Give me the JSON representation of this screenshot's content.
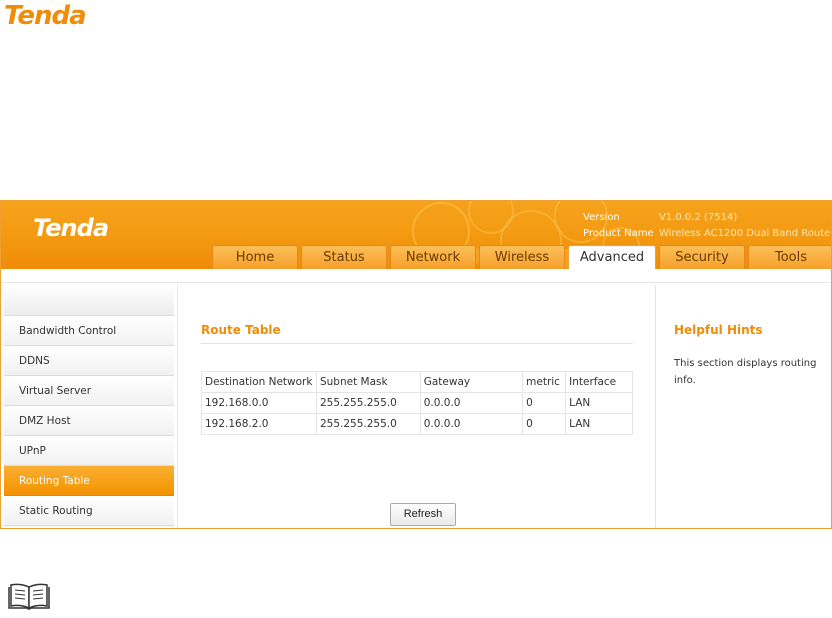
{
  "brand": {
    "logo_text": "Tenda",
    "accent_color": "#f39a12",
    "logo_color_doc": "#f08c08"
  },
  "header": {
    "version_label": "Version",
    "version_value": "V1.0.0.2 (7514)",
    "product_label": "Product Name",
    "product_value": "Wireless AC1200 Dual Band Router"
  },
  "tabs": [
    {
      "label": "Home"
    },
    {
      "label": "Status"
    },
    {
      "label": "Network"
    },
    {
      "label": "Wireless"
    },
    {
      "label": "Advanced",
      "active": true
    },
    {
      "label": "Security"
    },
    {
      "label": "Tools"
    }
  ],
  "sidebar": {
    "items": [
      {
        "label": "Bandwidth Control"
      },
      {
        "label": "DDNS"
      },
      {
        "label": "Virtual Server"
      },
      {
        "label": "DMZ Host"
      },
      {
        "label": "UPnP"
      },
      {
        "label": "Routing Table",
        "active": true
      },
      {
        "label": "Static Routing"
      }
    ]
  },
  "main": {
    "title": "Route Table",
    "columns": [
      "Destination Network",
      "Subnet Mask",
      "Gateway",
      "metric",
      "Interface"
    ],
    "rows": [
      [
        "192.168.0.0",
        "255.255.255.0",
        "0.0.0.0",
        "0",
        "LAN"
      ],
      [
        "192.168.2.0",
        "255.255.255.0",
        "0.0.0.0",
        "0",
        "LAN"
      ]
    ],
    "refresh_label": "Refresh"
  },
  "hints": {
    "title": "Helpful Hints",
    "text": "This section displays routing info."
  },
  "icons": {
    "note": "book-icon"
  }
}
